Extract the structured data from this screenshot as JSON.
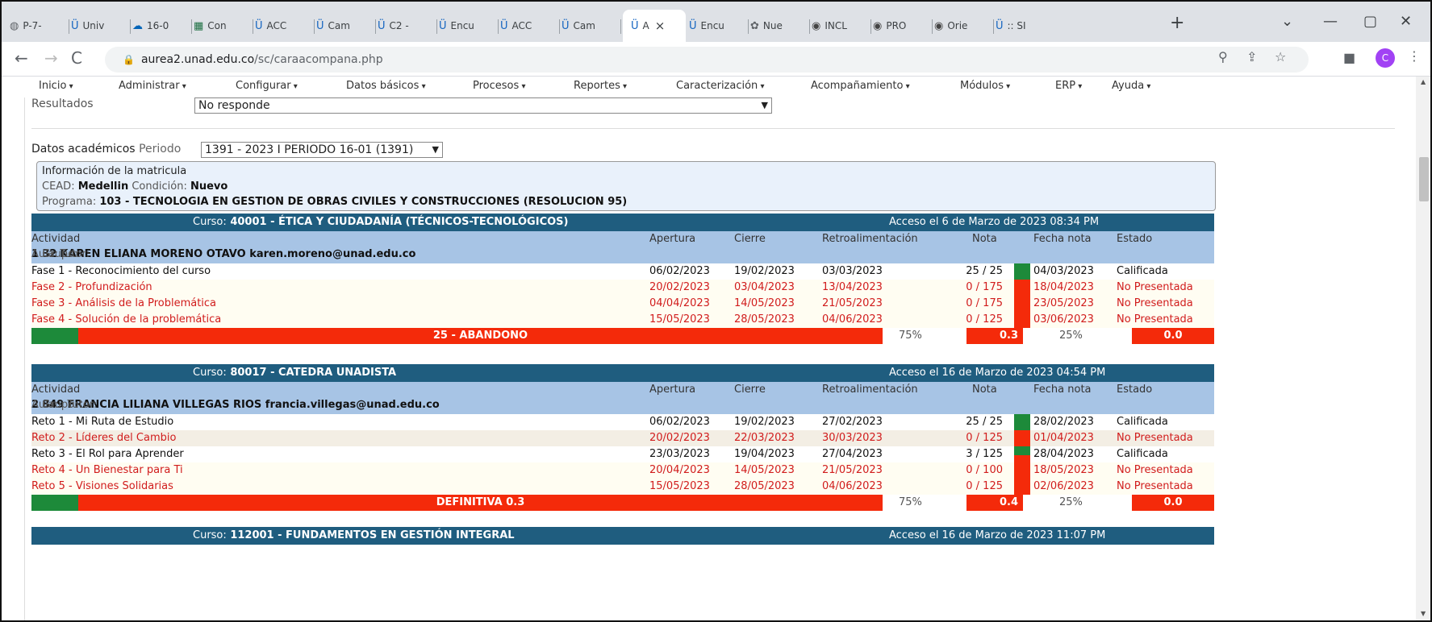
{
  "browser": {
    "tabs": [
      {
        "label": "P-7-",
        "icon": "globe-icon"
      },
      {
        "label": "Univ",
        "icon": "unad-icon"
      },
      {
        "label": "16-0",
        "icon": "cloud-icon"
      },
      {
        "label": "Con",
        "icon": "excel-icon"
      },
      {
        "label": "ACC",
        "icon": "unad-icon"
      },
      {
        "label": "Cam",
        "icon": "unad-icon"
      },
      {
        "label": "C2 -",
        "icon": "unad-icon"
      },
      {
        "label": "Encu",
        "icon": "unad-icon"
      },
      {
        "label": "ACC",
        "icon": "unad-icon"
      },
      {
        "label": "Cam",
        "icon": "unad-icon"
      },
      {
        "label": "A",
        "icon": "unad-icon"
      },
      {
        "label": "Encu",
        "icon": "unad-icon"
      },
      {
        "label": "Nue",
        "icon": "chatgpt-icon"
      },
      {
        "label": "INCL",
        "icon": "chrome-icon"
      },
      {
        "label": "PRO",
        "icon": "chrome-icon"
      },
      {
        "label": "Orie",
        "icon": "chrome-icon"
      },
      {
        "label": ":: SI",
        "icon": "unad-icon"
      }
    ],
    "url_host": "aurea2.unad.edu.co",
    "url_path": "/sc/caraacompana.php",
    "profile_initial": "C"
  },
  "menu": [
    "Inicio",
    "Administrar",
    "Configurar",
    "Datos básicos",
    "Procesos",
    "Reportes",
    "Caracterización",
    "Acompañamiento",
    "Módulos",
    "ERP",
    "Ayuda"
  ],
  "resultados": {
    "label": "Resultados",
    "value": "No responde"
  },
  "academicos": {
    "label": "Datos académicos",
    "periodo_label": "Periodo",
    "periodo_value": "1391 - 2023 I PERIODO 16-01 (1391)"
  },
  "matricula": {
    "title": "Información de la matricula",
    "cead_label": "CEAD:",
    "cead_value": "Medellin",
    "cond_label": "Condición:",
    "cond_value": "Nuevo",
    "prog_label": "Programa:",
    "prog_value": "103 - TECNOLOGIA EN GESTION DE OBRAS CIVILES Y CONSTRUCCIONES (RESOLUCION 95)"
  },
  "columns": {
    "actividad": "Actividad",
    "apertura": "Apertura",
    "cierre": "Cierre",
    "retro": "Retroalimentación",
    "nota": "Nota",
    "fecha_nota": "Fecha nota",
    "estado": "Estado"
  },
  "courses": [
    {
      "curso_label": "Curso:",
      "curso_name": "40001 - ÉTICA Y CIUDADANÍA (TÉCNICOS-TECNOLÓGICOS)",
      "acceso": "Acceso el 6 de Marzo de 2023 08:34 PM",
      "aula_label": "Aula:",
      "aula": "1",
      "grupo_label": "Grupo:",
      "grupo": "32",
      "tutor_label": "Tutor:",
      "tutor": "KAREN ELIANA MORENO OTAVO karen.moreno@unad.edu.co",
      "rows": [
        {
          "act": "Fase 1 - Reconocimiento del curso",
          "ap": "06/02/2023",
          "ci": "19/02/2023",
          "re": "03/03/2023",
          "nota": "25 / 25",
          "fn": "04/03/2023",
          "est": "Calificada",
          "ok": true
        },
        {
          "act": "Fase 2 - Profundización",
          "ap": "20/02/2023",
          "ci": "03/04/2023",
          "re": "13/04/2023",
          "nota": "0 / 175",
          "fn": "18/04/2023",
          "est": "No Presentada",
          "ok": false
        },
        {
          "act": "Fase 3 - Análisis de la Problemática",
          "ap": "04/04/2023",
          "ci": "14/05/2023",
          "re": "21/05/2023",
          "nota": "0 / 175",
          "fn": "23/05/2023",
          "est": "No Presentada",
          "ok": false
        },
        {
          "act": "Fase 4 - Solución de la problemática",
          "ap": "15/05/2023",
          "ci": "28/05/2023",
          "re": "04/06/2023",
          "nota": "0 / 125",
          "fn": "03/06/2023",
          "est": "No Presentada",
          "ok": false
        }
      ],
      "summary": {
        "label": "25 - ABANDONO",
        "pct1": "75%",
        "nota": "0.3",
        "pct2": "25%",
        "final": "0.0"
      }
    },
    {
      "curso_label": "Curso:",
      "curso_name": "80017 - CATEDRA UNADISTA",
      "acceso": "Acceso el 16 de Marzo de 2023 04:54 PM",
      "aula_label": "Aula:",
      "aula": "2",
      "grupo_label": "Grupo:",
      "grupo": "849",
      "tutor_label": "Tutor:",
      "tutor": "FRANCIA LILIANA VILLEGAS RIOS francia.villegas@unad.edu.co",
      "rows": [
        {
          "act": "Reto 1 - Mi Ruta de Estudio",
          "ap": "06/02/2023",
          "ci": "19/02/2023",
          "re": "27/02/2023",
          "nota": "25 / 25",
          "fn": "28/02/2023",
          "est": "Calificada",
          "ok": true
        },
        {
          "act": "Reto 2 - Líderes del Cambio",
          "ap": "20/02/2023",
          "ci": "22/03/2023",
          "re": "30/03/2023",
          "nota": "0 / 125",
          "fn": "01/04/2023",
          "est": "No Presentada",
          "ok": false
        },
        {
          "act": "Reto 3 - El Rol para Aprender",
          "ap": "23/03/2023",
          "ci": "19/04/2023",
          "re": "27/04/2023",
          "nota": "3 / 125",
          "fn": "28/04/2023",
          "est": "Calificada",
          "ok": true
        },
        {
          "act": "Reto 4 - Un Bienestar para Ti",
          "ap": "20/04/2023",
          "ci": "14/05/2023",
          "re": "21/05/2023",
          "nota": "0 / 100",
          "fn": "18/05/2023",
          "est": "No Presentada",
          "ok": false
        },
        {
          "act": "Reto 5 - Visiones Solidarias",
          "ap": "15/05/2023",
          "ci": "28/05/2023",
          "re": "04/06/2023",
          "nota": "0 / 125",
          "fn": "02/06/2023",
          "est": "No Presentada",
          "ok": false
        }
      ],
      "summary": {
        "label": "DEFINITIVA 0.3",
        "pct1": "75%",
        "nota": "0.4",
        "pct2": "25%",
        "final": "0.0"
      }
    },
    {
      "curso_label": "Curso:",
      "curso_name": "112001 - FUNDAMENTOS EN GESTIÓN INTEGRAL",
      "acceso": "Acceso el 16 de Marzo de 2023 11:07 PM"
    }
  ],
  "colors": {
    "course_header": "#1f5d7f",
    "col_header": "#a7c4e5",
    "danger": "#f42a0a",
    "success": "#1d8a3a",
    "late_text": "#d11c1c"
  }
}
